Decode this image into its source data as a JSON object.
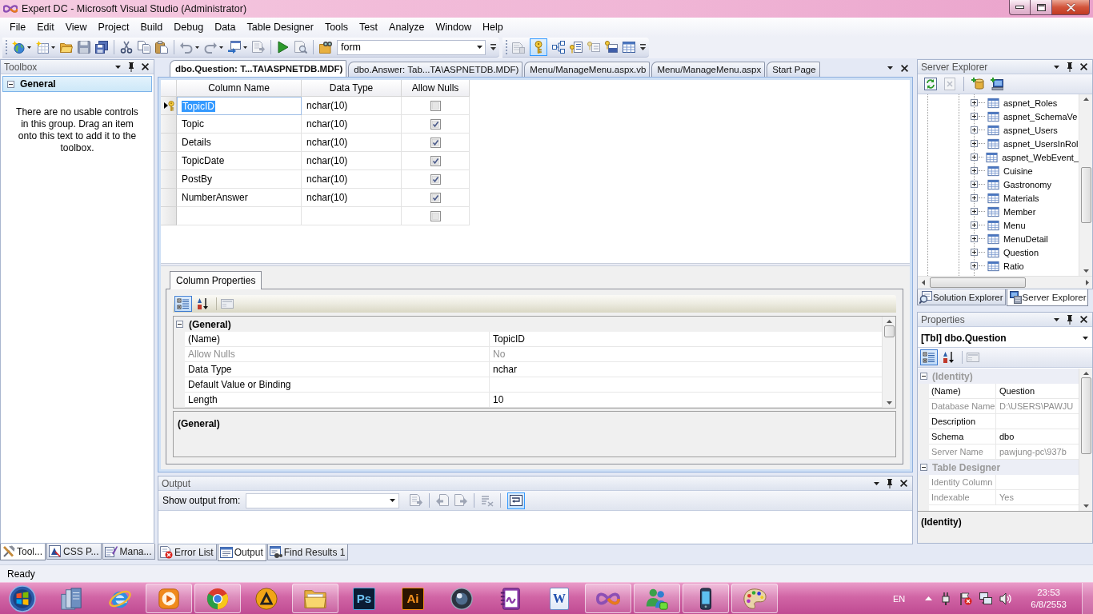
{
  "window": {
    "title": "Expert DC - Microsoft Visual Studio (Administrator)"
  },
  "menu": [
    "File",
    "Edit",
    "View",
    "Project",
    "Build",
    "Debug",
    "Data",
    "Table Designer",
    "Tools",
    "Test",
    "Analyze",
    "Window",
    "Help"
  ],
  "toolbar": {
    "find_value": "form",
    "primary_key_on": true
  },
  "toolbox": {
    "title": "Toolbox",
    "group": {
      "label": "General",
      "expanded": true,
      "selected": true
    },
    "message": "There are no usable controls in this group. Drag an item onto this text to add it to the toolbox."
  },
  "left_tabs": [
    {
      "kind": "toolbox",
      "label": "Tool...",
      "selected": true
    },
    {
      "kind": "css",
      "label": "CSS P...",
      "selected": false
    },
    {
      "kind": "styles",
      "label": "Mana...",
      "selected": false
    }
  ],
  "document_tabs": [
    {
      "label": "dbo.Question: T...TA\\ASPNETDB.MDF)",
      "selected": true
    },
    {
      "label": "dbo.Answer: Tab...TA\\ASPNETDB.MDF)",
      "selected": false
    },
    {
      "label": "Menu/ManageMenu.aspx.vb",
      "selected": false
    },
    {
      "label": "Menu/ManageMenu.aspx",
      "selected": false
    },
    {
      "label": "Start Page",
      "selected": false
    }
  ],
  "table_designer": {
    "columns": [
      "Column Name",
      "Data Type",
      "Allow Nulls"
    ],
    "rows": [
      {
        "name": "TopicID",
        "data_type": "nchar(10)",
        "allow_nulls": false,
        "primary_key": true,
        "selected": true
      },
      {
        "name": "Topic",
        "data_type": "nchar(10)",
        "allow_nulls": true,
        "primary_key": false,
        "selected": false
      },
      {
        "name": "Details",
        "data_type": "nchar(10)",
        "allow_nulls": true,
        "primary_key": false,
        "selected": false
      },
      {
        "name": "TopicDate",
        "data_type": "nchar(10)",
        "allow_nulls": true,
        "primary_key": false,
        "selected": false
      },
      {
        "name": "PostBy",
        "data_type": "nchar(10)",
        "allow_nulls": true,
        "primary_key": false,
        "selected": false
      },
      {
        "name": "NumberAnswer",
        "data_type": "nchar(10)",
        "allow_nulls": true,
        "primary_key": false,
        "selected": false
      },
      {
        "allow_nulls": false,
        "primary_key": false,
        "selected": false
      }
    ]
  },
  "column_properties": {
    "tab": "Column Properties",
    "sort_buttons": [
      {
        "kind": "categorized",
        "selected": true
      },
      {
        "kind": "alphabetical",
        "selected": false
      }
    ],
    "category": {
      "label": "(General)",
      "expanded": true,
      "disabled": false
    },
    "rows": [
      {
        "name": "(Name)",
        "value": "TopicID",
        "disabled": false
      },
      {
        "name": "Allow Nulls",
        "value": "No",
        "disabled": true
      },
      {
        "name": "Data Type",
        "value": "nchar",
        "disabled": false
      },
      {
        "name": "Default Value or Binding",
        "disabled": false
      },
      {
        "name": "Length",
        "value": "10",
        "disabled": false
      }
    ],
    "description": "(General)"
  },
  "output": {
    "title": "Output",
    "source_label": "Show output from:",
    "word_wrap": true
  },
  "output_tabs": [
    {
      "kind": "errors",
      "label": "Error List",
      "selected": false
    },
    {
      "kind": "output",
      "label": "Output",
      "selected": true
    },
    {
      "kind": "find",
      "label": "Find Results 1",
      "selected": false
    }
  ],
  "server_explorer": {
    "title": "Server Explorer",
    "tables": [
      {
        "label": "aspnet_Roles",
        "expanded": false
      },
      {
        "label": "aspnet_SchemaVe",
        "expanded": false
      },
      {
        "label": "aspnet_Users",
        "expanded": false
      },
      {
        "label": "aspnet_UsersInRol",
        "expanded": false
      },
      {
        "label": "aspnet_WebEvent_",
        "expanded": false
      },
      {
        "label": "Cuisine",
        "expanded": false
      },
      {
        "label": "Gastronomy",
        "expanded": false
      },
      {
        "label": "Materials",
        "expanded": false
      },
      {
        "label": "Member",
        "expanded": false
      },
      {
        "label": "Menu",
        "expanded": false
      },
      {
        "label": "MenuDetail",
        "expanded": false
      },
      {
        "label": "Question",
        "expanded": false
      },
      {
        "label": "Ratio",
        "expanded": false
      }
    ]
  },
  "explorer_tabs": [
    {
      "kind": "solution",
      "label": "Solution Explorer",
      "selected": false
    },
    {
      "kind": "server",
      "label": "Server Explorer",
      "selected": true
    }
  ],
  "properties": {
    "title": "Properties",
    "object": "[Tbl] dbo.Question",
    "sort_buttons": [
      {
        "kind": "categorized",
        "selected": true
      },
      {
        "kind": "alphabetical",
        "selected": false
      }
    ],
    "categories": [
      {
        "label": "(Identity)",
        "expanded": true,
        "disabled": true,
        "rows": [
          {
            "name": "(Name)",
            "value": "Question",
            "disabled": false
          },
          {
            "name": "Database Name",
            "value": "D:\\USERS\\PAWJU",
            "disabled": true
          },
          {
            "name": "Description",
            "disabled": false
          },
          {
            "name": "Schema",
            "value": "dbo",
            "disabled": false
          },
          {
            "name": "Server Name",
            "value": "pawjung-pc\\937b",
            "disabled": true
          }
        ]
      },
      {
        "label": "Table Designer",
        "expanded": true,
        "disabled": true,
        "rows": [
          {
            "name": "Identity Column",
            "disabled": true
          },
          {
            "name": "Indexable",
            "value": "Yes",
            "disabled": true
          }
        ]
      }
    ],
    "description": "(Identity)"
  },
  "status_bar": {
    "text": "Ready"
  },
  "taskbar": {
    "apps": [
      {
        "kind": "libraries",
        "running": false
      },
      {
        "kind": "globe",
        "running": false
      },
      {
        "kind": "player",
        "running": true
      },
      {
        "kind": "ring",
        "running": true
      },
      {
        "kind": "triangle",
        "running": false
      },
      {
        "kind": "folder",
        "running": true
      },
      {
        "kind": "pstile",
        "label": "Ps",
        "running": false
      },
      {
        "kind": "aitile",
        "label": "Ai",
        "running": false
      },
      {
        "kind": "sphere",
        "running": false
      },
      {
        "kind": "notebook",
        "running": false
      },
      {
        "kind": "document",
        "label": "W",
        "running": false
      },
      {
        "kind": "infinity",
        "running": true
      },
      {
        "kind": "people",
        "running": true
      },
      {
        "kind": "phone",
        "running": true
      },
      {
        "kind": "palette",
        "running": true
      }
    ],
    "tray": {
      "language": "EN",
      "time": "23:53",
      "date": "6/8/2553"
    }
  }
}
